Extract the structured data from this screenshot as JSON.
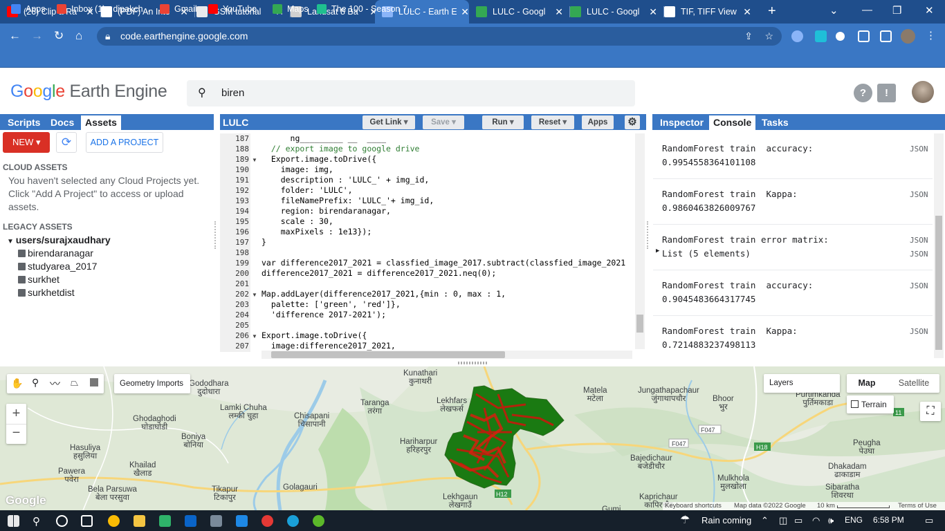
{
  "browser": {
    "tabs": [
      {
        "title": "(26) Clip a Ra",
        "color": "#ff0000"
      },
      {
        "title": "(PDF) An Inte",
        "color": "#ffffff"
      },
      {
        "title": "GSM tutorial",
        "color": "#e8eaed"
      },
      {
        "title": "Landsat 8 Ba",
        "color": "#d0d0d0"
      },
      {
        "title": "LULC - Earth E",
        "color": "#8ab4f8"
      },
      {
        "title": "LULC - Googl",
        "color": "#34a853"
      },
      {
        "title": "LULC - Googl",
        "color": "#34a853"
      },
      {
        "title": "TIF, TIFF View",
        "color": "#ffffff"
      }
    ],
    "close_glyph": "✕",
    "new_tab_glyph": "+",
    "url": "code.earthengine.google.com",
    "bookmarks": [
      {
        "label": "Apps",
        "color": "#4285f4"
      },
      {
        "label": "Inbox (1) - dipakch...",
        "color": "#ea4335"
      },
      {
        "label": "Gmail",
        "color": "#ea4335"
      },
      {
        "label": "YouTube",
        "color": "#ff0000"
      },
      {
        "label": "Maps",
        "color": "#34a853"
      },
      {
        "label": "The 100 - Season 7...",
        "color": "#1fbf8f"
      }
    ]
  },
  "header": {
    "logo_google": "Google",
    "logo_rest": "Earth Engine",
    "search_value": "biren",
    "help_glyph": "?",
    "feedback_glyph": "!"
  },
  "left_panel": {
    "tabs": [
      "Scripts",
      "Docs",
      "Assets"
    ],
    "active_tab": "Assets",
    "new_label": "NEW",
    "add_project_label": "ADD A PROJECT",
    "cloud_assets_title": "CLOUD ASSETS",
    "cloud_message": "You haven't selected any Cloud Projects yet. Click \"Add A Project\" to access or upload assets.",
    "legacy_title": "LEGACY ASSETS",
    "user_root": "users/surajxaudhary",
    "assets": [
      "birendaranagar",
      "studyarea_2017",
      "surkhet",
      "surkhetdist"
    ]
  },
  "editor": {
    "script_name": "LULC",
    "buttons": {
      "get_link": "Get Link",
      "save": "Save",
      "run": "Run",
      "reset": "Reset",
      "apps": "Apps"
    },
    "line_numbers": [
      "187",
      "188",
      "189",
      "190",
      "191",
      "192",
      "193",
      "194",
      "195",
      "196",
      "197",
      "198",
      "199",
      "200",
      "201",
      "202",
      "203",
      "204",
      "205",
      "206",
      "207"
    ],
    "lines": [
      "      ng_________ __  ____",
      "  // export image to google drive",
      "  Export.image.toDrive({",
      "    image: img,",
      "    description : 'LULC_' + img_id,",
      "    folder: 'LULC',",
      "    fileNamePrefix: 'LULC_'+ img_id,",
      "    region: birendaranagar,",
      "    scale : 30,",
      "    maxPixels : 1e13});",
      "}",
      "",
      "var difference2017_2021 = classfied_image_2017.subtract(classfied_image_2021",
      "difference2017_2021 = difference2017_2021.neq(0);",
      "",
      "Map.addLayer(difference2017_2021,{min : 0, max : 1,",
      "  palette: ['green', 'red']},",
      "  'difference 2017-2021');",
      "",
      "Export.image.toDrive({",
      "  image:difference2017_2021,"
    ]
  },
  "right_panel": {
    "tabs": [
      "Inspector",
      "Console",
      "Tasks"
    ],
    "active_tab": "Console",
    "entries": [
      {
        "line1": "RandomForest train  accuracy:",
        "line2": "0.9954558364101108",
        "tag": "JSON",
        "tag2": ""
      },
      {
        "line1": "RandomForest train  Kappa:",
        "line2": "0.9860463826009767",
        "tag": "JSON",
        "tag2": ""
      },
      {
        "line1": "RandomForest train error matrix:",
        "line2": "List (5 elements)",
        "tag": "JSON",
        "tag2": "JSON"
      },
      {
        "line1": "RandomForest train  accuracy:",
        "line2": "0.9045483664317745",
        "tag": "JSON",
        "tag2": ""
      },
      {
        "line1": "RandomForest train  Kappa:",
        "line2": "0.7214883237498113",
        "tag": "JSON",
        "tag2": ""
      }
    ]
  },
  "map": {
    "geometry_imports": "Geometry Imports",
    "layers": "Layers",
    "map_btn": "Map",
    "satellite_btn": "Satellite",
    "terrain": "Terrain",
    "zoom_in": "+",
    "zoom_out": "−",
    "google_mark": "Google",
    "attribution": [
      "Keyboard shortcuts",
      "Map data ©2022 Google",
      "10 km",
      "Terms of Use"
    ],
    "places": [
      {
        "name": "Kunathari",
        "local": "कुनाथरी"
      },
      {
        "name": "Matela",
        "local": "मटेला"
      },
      {
        "name": "Jungathapachaur",
        "local": "जुंगाथापचौर"
      },
      {
        "name": "Bhoor",
        "local": "भुर"
      },
      {
        "name": "Purtimkanda",
        "local": "पुर्तिमकाडा"
      },
      {
        "name": "Gododhara",
        "local": "दुदोधारा"
      },
      {
        "name": "Lamki Chuha",
        "local": "लम्की चुहा"
      },
      {
        "name": "Chisapani",
        "local": "चिसापानी"
      },
      {
        "name": "Taranga",
        "local": "तरंगा"
      },
      {
        "name": "Lekhfars",
        "local": "लेखफर्स"
      },
      {
        "name": "Ghodaghodi",
        "local": "घोडाघोडी"
      },
      {
        "name": "Boniya",
        "local": "बोनिया"
      },
      {
        "name": "Hariharpur",
        "local": "हरिहरपुर"
      },
      {
        "name": "Hasuliya",
        "local": "हसुलिया"
      },
      {
        "name": "Khailad",
        "local": "खैलाड"
      },
      {
        "name": "Pawera",
        "local": "पवेरा"
      },
      {
        "name": "Bela Parsuwa",
        "local": "बेला परसुवा"
      },
      {
        "name": "Tikapur",
        "local": "टिकापुर"
      },
      {
        "name": "Golagauri",
        "local": ""
      },
      {
        "name": "Lekhgaun",
        "local": "लेखगाउँ"
      },
      {
        "name": "Bajedichaur",
        "local": "बजेडीचौर"
      },
      {
        "name": "Peugha",
        "local": "पेउघा"
      },
      {
        "name": "Dhakadam",
        "local": "ढाकाडाम"
      },
      {
        "name": "Mulkhola",
        "local": "मुलखोला"
      },
      {
        "name": "Sibaratha",
        "local": "शिवरथा"
      },
      {
        "name": "Kaprichaur",
        "local": "कापिरचौर"
      },
      {
        "name": "Gumi",
        "local": ""
      }
    ],
    "roads": [
      "F047",
      "F047",
      "H18",
      "H12",
      "11"
    ]
  },
  "taskbar": {
    "weather": "Rain coming",
    "lang": "ENG",
    "time": "6:58 PM"
  }
}
